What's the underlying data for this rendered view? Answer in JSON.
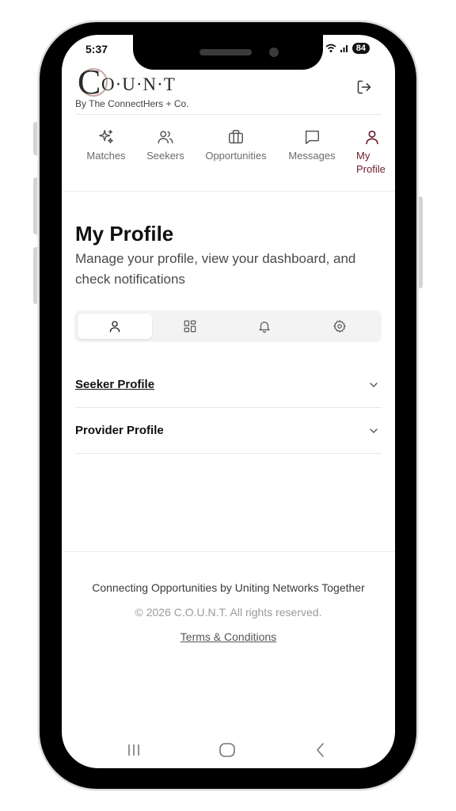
{
  "status_bar": {
    "time": "5:37",
    "battery": "84",
    "icons": [
      "cloud-icon",
      "wifi-icon",
      "signal-icon",
      "battery-icon"
    ]
  },
  "header": {
    "logo_initial": "C",
    "logo_rest": "O·U·N·T",
    "tagline": "By The ConnectHers + Co.",
    "logout_icon": "logout-icon"
  },
  "nav": {
    "items": [
      {
        "label": "Matches",
        "icon": "sparkles-icon"
      },
      {
        "label": "Seekers",
        "icon": "users-icon"
      },
      {
        "label": "Opportunities",
        "icon": "briefcase-icon"
      },
      {
        "label": "Messages",
        "icon": "message-icon"
      },
      {
        "label_line1": "My",
        "label_line2": "Profile",
        "icon": "user-icon",
        "active": true
      }
    ]
  },
  "page": {
    "title": "My Profile",
    "subtitle": "Manage your profile, view your dashboard, and check notifications"
  },
  "tabs": [
    {
      "icon": "user-icon",
      "active": true
    },
    {
      "icon": "dashboard-icon"
    },
    {
      "icon": "bell-icon"
    },
    {
      "icon": "gear-icon"
    }
  ],
  "accordion": [
    {
      "label": "Seeker Profile"
    },
    {
      "label": "Provider Profile"
    }
  ],
  "footer": {
    "tagline": "Connecting Opportunities by Uniting Networks Together",
    "copyright": "© 2026 C.O.U.N.T. All rights reserved.",
    "terms": "Terms & Conditions"
  },
  "colors": {
    "accent": "#6b1c2b",
    "nav_inactive": "#6b6b6b",
    "text": "#111111"
  }
}
